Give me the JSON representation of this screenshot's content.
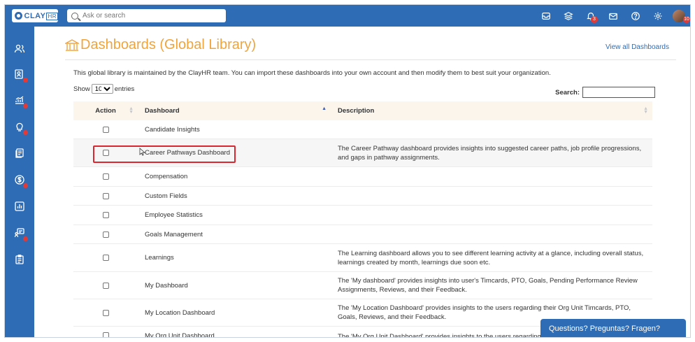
{
  "brand": {
    "name": "CLAY",
    "suffix": "HR"
  },
  "topbar": {
    "search_placeholder": "Ask or search",
    "notification_count": "3",
    "avatar_badge": "10"
  },
  "page": {
    "title": "Dashboards (Global Library)",
    "view_all_link": "View all Dashboards",
    "intro": "This global library is maintained by the ClayHR team. You can import these dashboards into your own account and then modify them to best suit your organization."
  },
  "table_controls": {
    "show_label": "Show",
    "entries_label": "entries",
    "page_size": "10",
    "search_label": "Search:"
  },
  "table": {
    "headers": [
      "Action",
      "Dashboard",
      "Description"
    ],
    "rows": [
      {
        "dashboard": "Candidate Insights",
        "description": ""
      },
      {
        "dashboard": "Career Pathways Dashboard",
        "description": "The Career Pathway dashboard provides insights into suggested career paths, job profile progressions, and gaps in pathway assignments."
      },
      {
        "dashboard": "Compensation",
        "description": ""
      },
      {
        "dashboard": "Custom Fields",
        "description": ""
      },
      {
        "dashboard": "Employee Statistics",
        "description": ""
      },
      {
        "dashboard": "Goals Management",
        "description": ""
      },
      {
        "dashboard": "Learnings",
        "description": "The Learning dashboard allows you to see different learning activity at a glance, including overall status, learnings created by month, learnings due soon etc."
      },
      {
        "dashboard": "My Dashboard",
        "description": "The 'My dashboard' provides insights into user's Timcards, PTO, Goals, Pending Performance Review Assignments, Reviews, and their Feedback."
      },
      {
        "dashboard": "My Location Dashboard",
        "description": "The 'My Location Dashboard' provides insights to the users regarding their Org Unit Timcards, PTO, Goals, Reviews, and their Feedback."
      },
      {
        "dashboard": "My Org Unit Dashboard",
        "description": "The 'My Org Unit Dashboard' provides insights to the users regarding their"
      }
    ]
  },
  "chat": {
    "label": "Questions? Preguntas? Fragen?"
  },
  "colors": {
    "brand_blue": "#2e6db6",
    "title_orange": "#f0a53c",
    "highlight_red": "#d9282f",
    "badge_red": "#e53935"
  }
}
